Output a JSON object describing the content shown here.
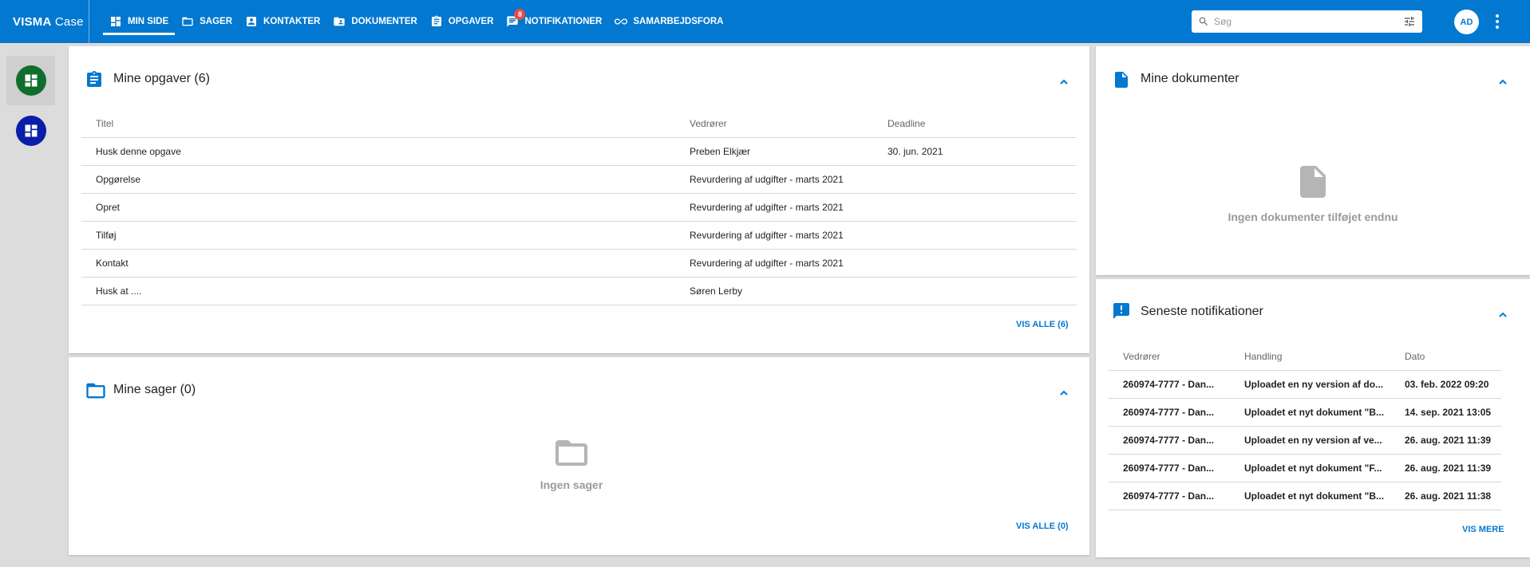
{
  "app": {
    "logo_bold": "VISMA",
    "logo_light": " Case"
  },
  "nav": {
    "items": [
      {
        "label": "MIN SIDE",
        "icon": "dashboard-icon"
      },
      {
        "label": "SAGER",
        "icon": "folder-icon"
      },
      {
        "label": "KONTAKTER",
        "icon": "contact-icon"
      },
      {
        "label": "DOKUMENTER",
        "icon": "folder-shared-icon"
      },
      {
        "label": "OPGAVER",
        "icon": "assignment-icon"
      },
      {
        "label": "NOTIFIKATIONER",
        "icon": "chat-icon",
        "badge": "8"
      },
      {
        "label": "SAMARBEJDSFORA",
        "icon": "infinity-icon"
      }
    ]
  },
  "search": {
    "placeholder": "Søg",
    "value": ""
  },
  "user": {
    "initials": "AD"
  },
  "colors": {
    "primary": "#0278d0",
    "sidebar_green": "#0f6e2c",
    "sidebar_blue": "#0a1ea8",
    "badge": "#e84a4a"
  },
  "tasks": {
    "title": "Mine opgaver (6)",
    "columns": [
      "Titel",
      "Vedrører",
      "Deadline"
    ],
    "rows": [
      [
        "Husk denne opgave",
        "Preben Elkjær",
        "30. jun. 2021"
      ],
      [
        "Opgørelse",
        "Revurdering af udgifter - marts 2021",
        ""
      ],
      [
        "Opret",
        "Revurdering af udgifter - marts 2021",
        ""
      ],
      [
        "Tilføj",
        "Revurdering af udgifter - marts 2021",
        ""
      ],
      [
        "Kontakt",
        "Revurdering af udgifter - marts 2021",
        ""
      ],
      [
        "Husk at ....",
        "Søren Lerby",
        ""
      ]
    ],
    "show_all": "VIS ALLE (6)"
  },
  "cases": {
    "title": "Mine sager (0)",
    "empty_text": "Ingen sager",
    "show_all": "VIS ALLE (0)"
  },
  "documents": {
    "title": "Mine dokumenter",
    "empty_text": "Ingen dokumenter tilføjet endnu"
  },
  "notifications": {
    "title": "Seneste notifikationer",
    "columns": [
      "Vedrører",
      "Handling",
      "Dato"
    ],
    "rows": [
      [
        "260974-7777 - Dan...",
        "Uploadet en ny version af do...",
        "03. feb. 2022 09:20"
      ],
      [
        "260974-7777 - Dan...",
        "Uploadet et nyt dokument \"B...",
        "14. sep. 2021 13:05"
      ],
      [
        "260974-7777 - Dan...",
        "Uploadet en ny version af ve...",
        "26. aug. 2021 11:39"
      ],
      [
        "260974-7777 - Dan...",
        "Uploadet et nyt dokument \"F...",
        "26. aug. 2021 11:39"
      ],
      [
        "260974-7777 - Dan...",
        "Uploadet et nyt dokument \"B...",
        "26. aug. 2021 11:38"
      ]
    ],
    "show_more": "VIS MERE"
  }
}
